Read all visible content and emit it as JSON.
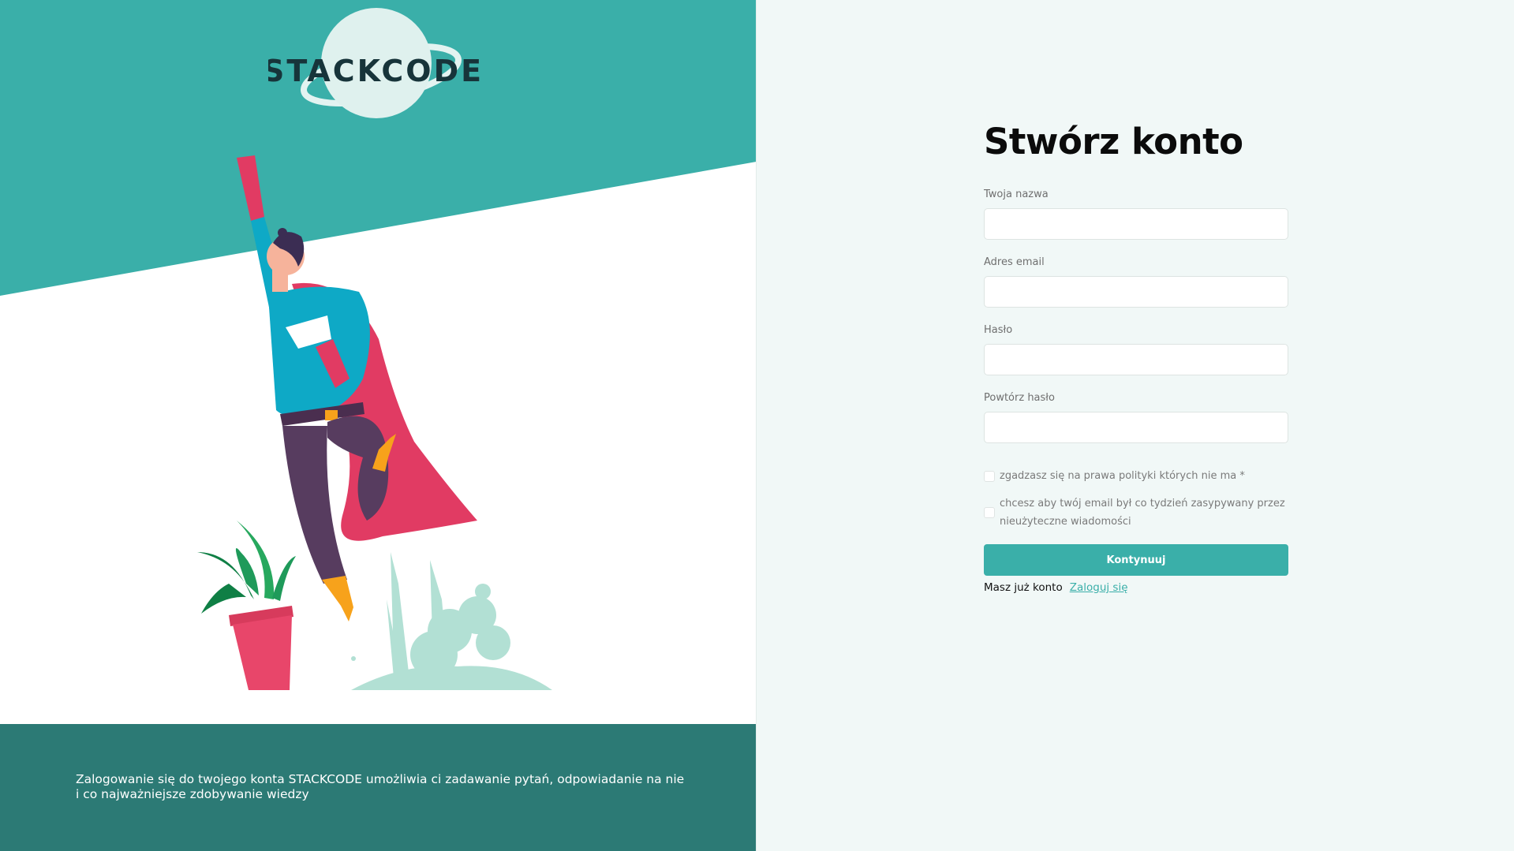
{
  "brand": {
    "logo_text": "STACKCODE"
  },
  "left_panel": {
    "description": "Zalogowanie się do twojego konta STACKCODE umożliwia ci zadawanie pytań, odpowiadanie na nie i co najważniejsze zdobywanie wiedzy",
    "colors": {
      "teal_top": "#3aafa9",
      "footer": "#2c7a75"
    }
  },
  "form": {
    "title": "Stwórz konto",
    "fields": [
      {
        "label": "Twoja nazwa",
        "value": "",
        "placeholder": ""
      },
      {
        "label": "Adres email",
        "value": "",
        "placeholder": ""
      },
      {
        "label": "Hasło",
        "value": "",
        "placeholder": ""
      },
      {
        "label": "Powtórz hasło",
        "value": "",
        "placeholder": ""
      }
    ],
    "checkboxes": [
      {
        "label": "zgadzasz się na prawa polityki których nie ma *",
        "checked": false
      },
      {
        "label": "chcesz aby twój email był co tydzień zasypywany przez nieużyteczne wiadomości",
        "checked": false
      }
    ],
    "submit_label": "Kontynuuj",
    "signin_prompt": "Masz już konto",
    "signin_link": "Zaloguj się"
  },
  "colors": {
    "accent": "#3aafa9",
    "right_bg": "#f1f8f7"
  }
}
